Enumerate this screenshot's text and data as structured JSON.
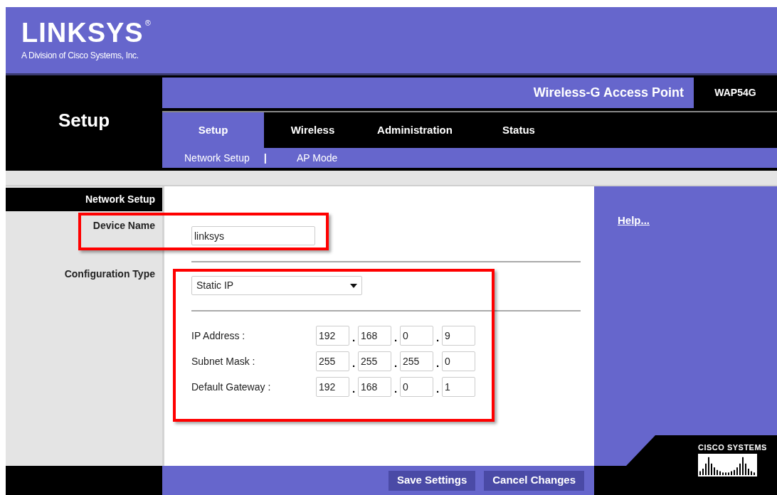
{
  "header": {
    "logo": "LINKSYS",
    "registered_mark": "®",
    "tagline": "A Division of Cisco Systems, Inc."
  },
  "section_title": "Setup",
  "product_name": "Wireless-G Access Point",
  "model": "WAP54G",
  "tabs": [
    {
      "label": "Setup",
      "selected": true
    },
    {
      "label": "Wireless",
      "selected": false
    },
    {
      "label": "Administration",
      "selected": false
    },
    {
      "label": "Status",
      "selected": false
    }
  ],
  "subtabs": [
    {
      "label": "Network Setup"
    },
    {
      "label": "AP Mode"
    }
  ],
  "subtab_separator": "|",
  "sidebar": {
    "heading": "Network Setup",
    "labels": [
      "Device Name",
      "Configuration Type"
    ]
  },
  "device_name": {
    "value": "linksys"
  },
  "configuration_type": {
    "value": "Static IP"
  },
  "ip_rows": [
    {
      "label": "IP Address :",
      "octets": [
        "192",
        "168",
        "0",
        "9"
      ]
    },
    {
      "label": "Subnet Mask :",
      "octets": [
        "255",
        "255",
        "255",
        "0"
      ]
    },
    {
      "label": "Default Gateway :",
      "octets": [
        "192",
        "168",
        "0",
        "1"
      ]
    }
  ],
  "octet_separator": ".",
  "help_link": "Help...",
  "buttons": [
    "Save Settings",
    "Cancel Changes"
  ],
  "footer_logo": "CISCO SYSTEMS",
  "annotations": [
    {
      "kind": "highlight"
    },
    {
      "kind": "highlight"
    }
  ]
}
